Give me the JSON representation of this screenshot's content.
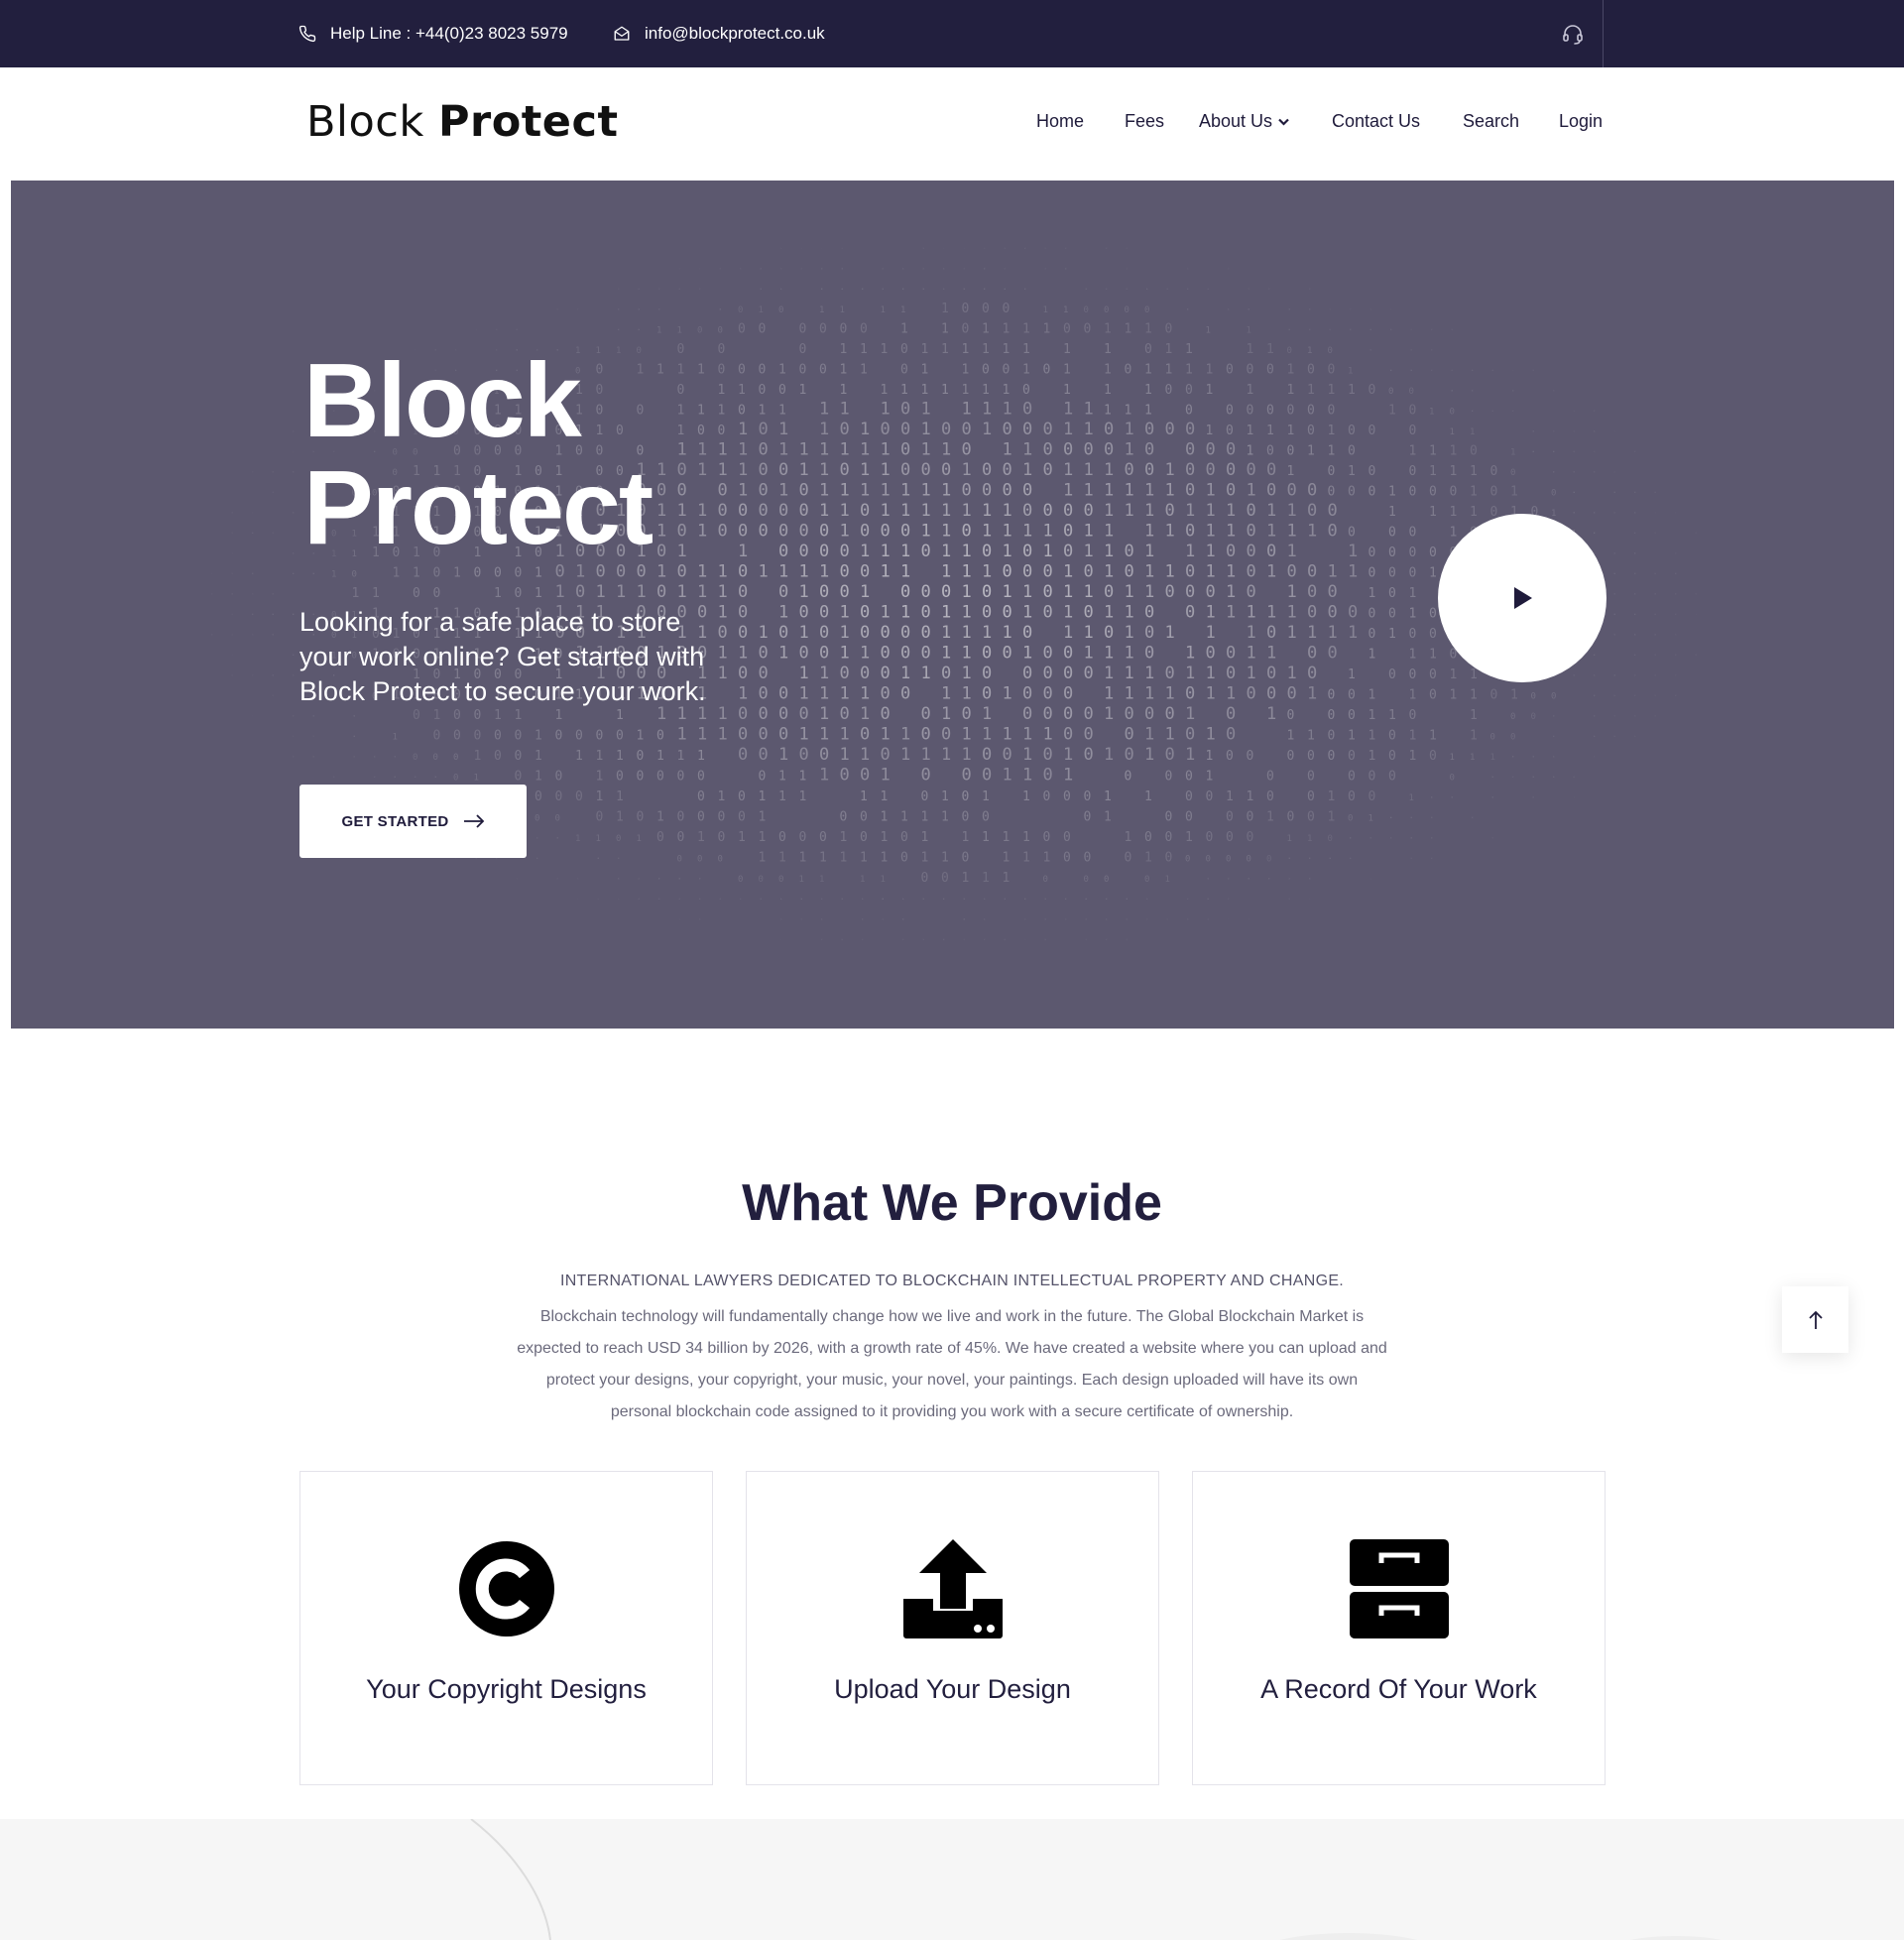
{
  "topbar": {
    "helpline": "Help Line : +44(0)23 8023 5979",
    "email": "info@blockprotect.co.uk",
    "icons": [
      "phone-icon",
      "mail-icon",
      "headset-icon"
    ]
  },
  "header": {
    "logo_light": "Block",
    "logo_bold": "Protect",
    "nav": {
      "home": "Home",
      "fees": "Fees",
      "about": "About Us",
      "contact": "Contact Us",
      "search": "Search",
      "login": "Login"
    }
  },
  "hero": {
    "title_line1": "Block",
    "title_line2": "Protect",
    "subtitle": "Looking for a safe place to store your work online? Get started with Block Protect to secure your work.",
    "button_label": "GET STARTED"
  },
  "provide": {
    "title": "What We Provide",
    "tagline": "INTERNATIONAL LAWYERS DEDICATED TO BLOCKCHAIN INTELLECTUAL PROPERTY AND CHANGE.",
    "text": "Blockchain technology will fundamentally change how we live and work in the future. The Global Blockchain Market is expected to reach USD 34 billion by 2026, with a growth rate of 45%. We have created a website where you can upload and protect your designs, your copyright, your music, your novel, your paintings. Each design uploaded will have its own personal blockchain code assigned to it providing you work with a secure certificate of ownership.",
    "cards": [
      {
        "title": "Your Copyright Designs",
        "icon": "copyright-icon"
      },
      {
        "title": "Upload Your Design",
        "icon": "upload-icon"
      },
      {
        "title": "A Record Of Your Work",
        "icon": "archive-icon"
      }
    ]
  },
  "colors": {
    "topbar_bg": "#221f3e",
    "hero_bg": "#5c586f",
    "text_dark": "#221f3e"
  }
}
